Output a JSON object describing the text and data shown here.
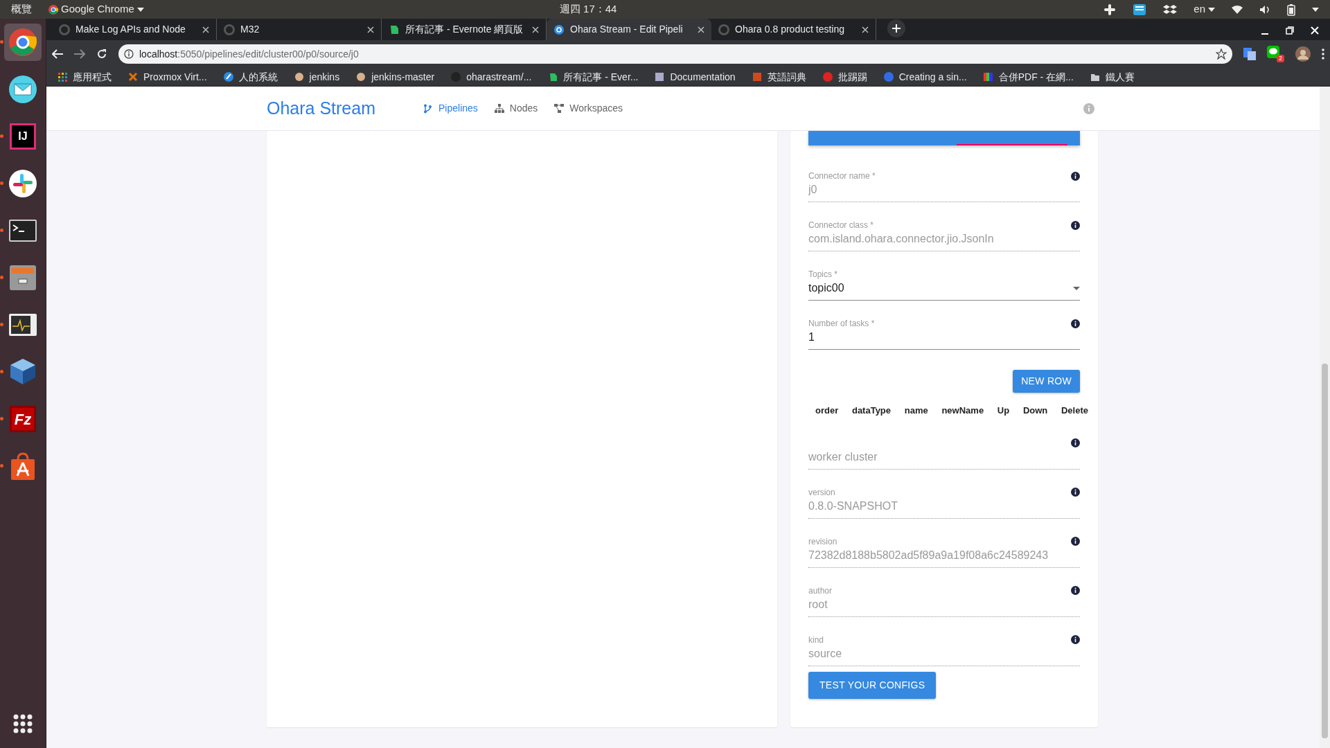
{
  "top_bar": {
    "activities": "概覽",
    "app": "Google Chrome",
    "clock": "週四 17：44",
    "language": "en"
  },
  "dock": [
    {
      "running": true,
      "active": true
    },
    {
      "running": false,
      "active": false
    },
    {
      "running": true,
      "active": false,
      "glyph": "IJ"
    },
    {
      "running": true,
      "active": false
    },
    {
      "running": true,
      "active": false
    },
    {
      "running": true,
      "active": false
    },
    {
      "running": true,
      "active": false
    },
    {
      "running": true,
      "active": false
    },
    {
      "running": true,
      "active": false,
      "glyph": "Fz"
    },
    {
      "running": true,
      "active": false
    }
  ],
  "browser": {
    "tabs": [
      {
        "title": "Make Log APIs and Node",
        "selected": false
      },
      {
        "title": "M32",
        "selected": false
      },
      {
        "title": "所有記事 - Evernote 網頁版",
        "selected": false
      },
      {
        "title": "Ohara Stream - Edit Pipeli",
        "selected": true
      },
      {
        "title": "Ohara 0.8 product testing",
        "selected": false
      }
    ],
    "url_host": "localhost",
    "url_path": ":5050/pipelines/edit/cluster00/p0/source/j0",
    "extension_badge": "2",
    "bookmarks": [
      {
        "label": "應用程式"
      },
      {
        "label": "Proxmox Virt..."
      },
      {
        "label": "人的系統"
      },
      {
        "label": "jenkins"
      },
      {
        "label": "jenkins-master"
      },
      {
        "label": "oharastream/..."
      },
      {
        "label": "所有記事 - Ever..."
      },
      {
        "label": "Documentation"
      },
      {
        "label": "英語詞典"
      },
      {
        "label": "批踢踢"
      },
      {
        "label": "Creating a sin..."
      },
      {
        "label": "合併PDF - 在網..."
      },
      {
        "label": "鐵人賽"
      }
    ]
  },
  "page": {
    "brand": "Ohara Stream",
    "nav": [
      {
        "label": "Pipelines",
        "selected": true
      },
      {
        "label": "Nodes",
        "selected": false
      },
      {
        "label": "Workspaces",
        "selected": false
      }
    ],
    "form_tabs": [
      {
        "selected": false
      },
      {
        "selected": true
      }
    ],
    "fields": [
      {
        "kind": "readonly",
        "label": "Connector name *",
        "value": "j0"
      },
      {
        "kind": "readonly",
        "label": "Connector class *",
        "value": "com.island.ohara.connector.jio.JsonIn"
      },
      {
        "kind": "select",
        "label": "Topics *",
        "value": "topic00"
      },
      {
        "kind": "input",
        "label": "Number of tasks *",
        "value": "1"
      }
    ],
    "new_row_button": "NEW ROW",
    "columns": [
      "order",
      "dataType",
      "name",
      "newName",
      "Up",
      "Down",
      "Delete"
    ],
    "info_fields": [
      {
        "kind": "readonly",
        "placeholder": "worker cluster"
      },
      {
        "kind": "readonly",
        "label": "version",
        "value": "0.8.0-SNAPSHOT"
      },
      {
        "kind": "readonly",
        "label": "revision",
        "value": "72382d8188b5802ad5f89a9a19f08a6c24589243"
      },
      {
        "kind": "readonly",
        "label": "author",
        "value": "root"
      },
      {
        "kind": "readonly",
        "label": "kind",
        "value": "source"
      }
    ],
    "test_button": "TEST YOUR CONFIGS"
  }
}
